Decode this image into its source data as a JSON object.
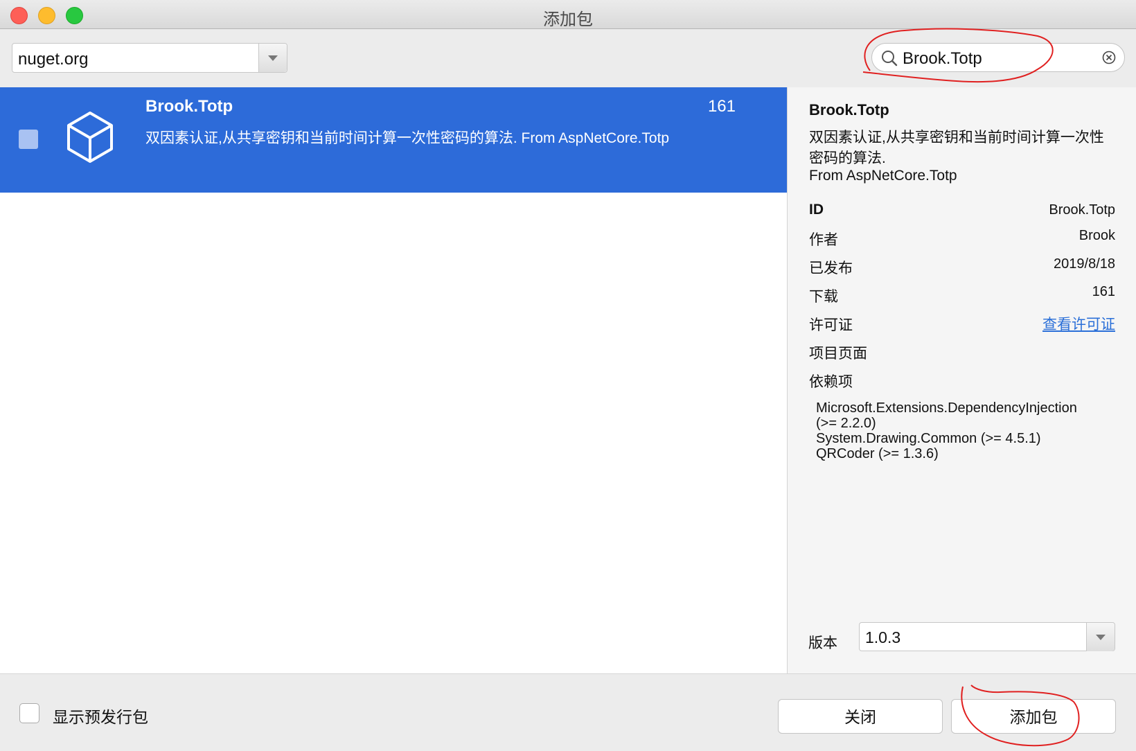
{
  "window": {
    "title": "添加包"
  },
  "toolbar": {
    "source": "nuget.org",
    "search_value": "Brook.Totp"
  },
  "package_list": [
    {
      "name": "Brook.Totp",
      "downloads": "161",
      "description": "双因素认证,从共享密钥和当前时间计算一次性密码的算法. From AspNetCore.Totp",
      "selected": true,
      "checked": false
    }
  ],
  "details": {
    "title": "Brook.Totp",
    "description": "双因素认证,从共享密钥和当前时间计算一次性密码的算法.",
    "from": "From AspNetCore.Totp",
    "fields": {
      "id_label": "ID",
      "id_value": "Brook.Totp",
      "author_label": "作者",
      "author_value": "Brook",
      "published_label": "已发布",
      "published_value": "2019/8/18",
      "downloads_label": "下载",
      "downloads_value": "161",
      "license_label": "许可证",
      "license_link": "查看许可证",
      "project_label": "项目页面",
      "deps_label": "依赖项"
    },
    "dependencies": [
      "Microsoft.Extensions.DependencyInjection\n(>= 2.2.0)",
      "System.Drawing.Common (>= 4.5.1)",
      "QRCoder (>= 1.3.6)"
    ],
    "version_label": "版本",
    "version_value": "1.0.3"
  },
  "footer": {
    "prerelease_label": "显示预发行包",
    "prerelease_checked": false,
    "close_button": "关闭",
    "add_button": "添加包"
  },
  "colors": {
    "selection": "#2d6bd9",
    "link": "#2a6fd8",
    "annotation": "#e02020"
  }
}
